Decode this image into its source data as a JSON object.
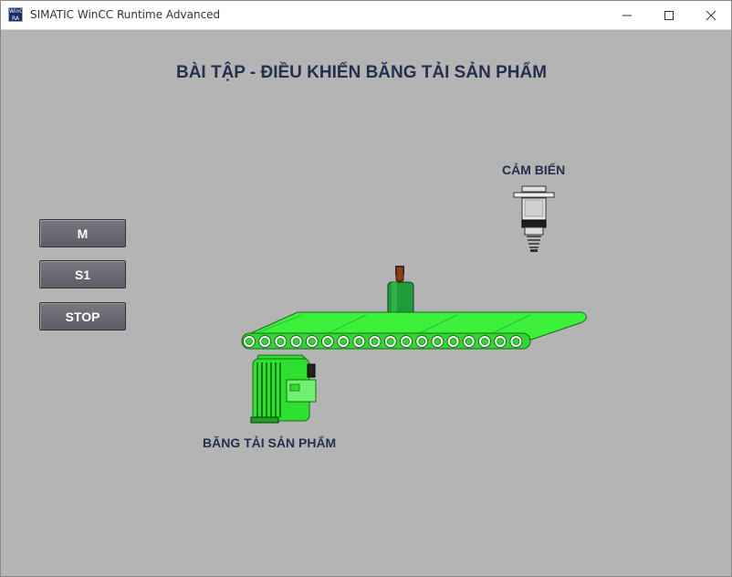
{
  "window": {
    "title": "SIMATIC WinCC Runtime Advanced",
    "app_icon_text": "WinCC RA"
  },
  "screen": {
    "title": "BÀI TẬP - ĐIỀU KHIỂN BĂNG TẢI SẢN PHẨM",
    "sensor_label": "CẢM BIẾN",
    "conveyor_label": "BĂNG TẢI SẢN PHẨM"
  },
  "buttons": {
    "m": "M",
    "s1": "S1",
    "stop": "STOP"
  },
  "colors": {
    "background": "#b4b4b4",
    "conveyor_green": "#3cf03c",
    "motor_green": "#2ee02e",
    "bottle_green": "#1f9b3a",
    "text_navy": "#25304f",
    "button_grey": "#6a6b73"
  },
  "icons": {
    "minimize": "minimize-icon",
    "maximize": "maximize-icon",
    "close": "close-icon"
  }
}
